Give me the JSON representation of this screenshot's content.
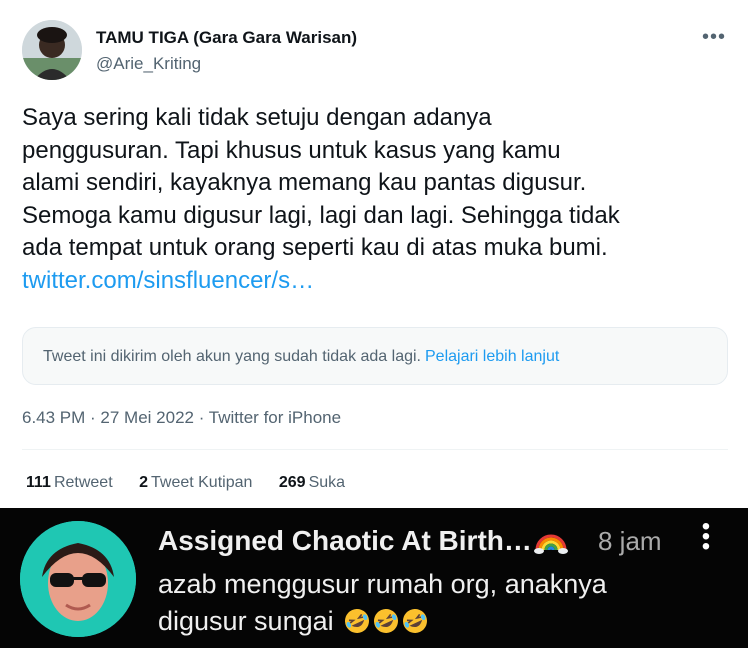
{
  "tweet": {
    "author": {
      "name": "TAMU TIGA (Gara Gara Warisan)",
      "handle": "@Arie_Kriting",
      "avatar_icon": "profile-photo"
    },
    "more_icon": "more-horizontal-icon",
    "text_lines": [
      "Saya sering kali tidak setuju dengan adanya",
      "penggusuran. Tapi khusus untuk kasus yang kamu",
      "alami sendiri, kayaknya memang kau pantas digusur.",
      "Semoga kamu digusur lagi, lagi dan lagi. Sehingga tidak",
      "ada tempat untuk orang seperti kau di atas muka bumi."
    ],
    "link_text": "twitter.com/sinsfluencer/s…",
    "notice": {
      "text": "Tweet ini dikirim oleh akun yang sudah tidak ada lagi.",
      "link": "Pelajari lebih lanjut"
    },
    "meta": "6.43 PM · 27 Mei 2022 · Twitter for iPhone",
    "stats": {
      "retweet_count": "111",
      "retweet_label": "Retweet",
      "quote_count": "2",
      "quote_label": "Tweet Kutipan",
      "like_count": "269",
      "like_label": "Suka"
    },
    "colors": {
      "link": "#1d9bf0",
      "text": "#0f1419",
      "muted": "#536471"
    }
  },
  "comment": {
    "author": "Assigned Chaotic At Birth…",
    "author_emoji": "rainbow-icon",
    "time": "8 jam",
    "more_icon": "more-vertical-icon",
    "text_lines": [
      "azab menggusur rumah org, anaknya",
      "digusur sungai"
    ],
    "emojis": [
      "rolling-laughing-icon",
      "rolling-laughing-icon",
      "rolling-laughing-icon"
    ],
    "colors": {
      "background": "#050505",
      "text": "#f0f0f0"
    }
  }
}
